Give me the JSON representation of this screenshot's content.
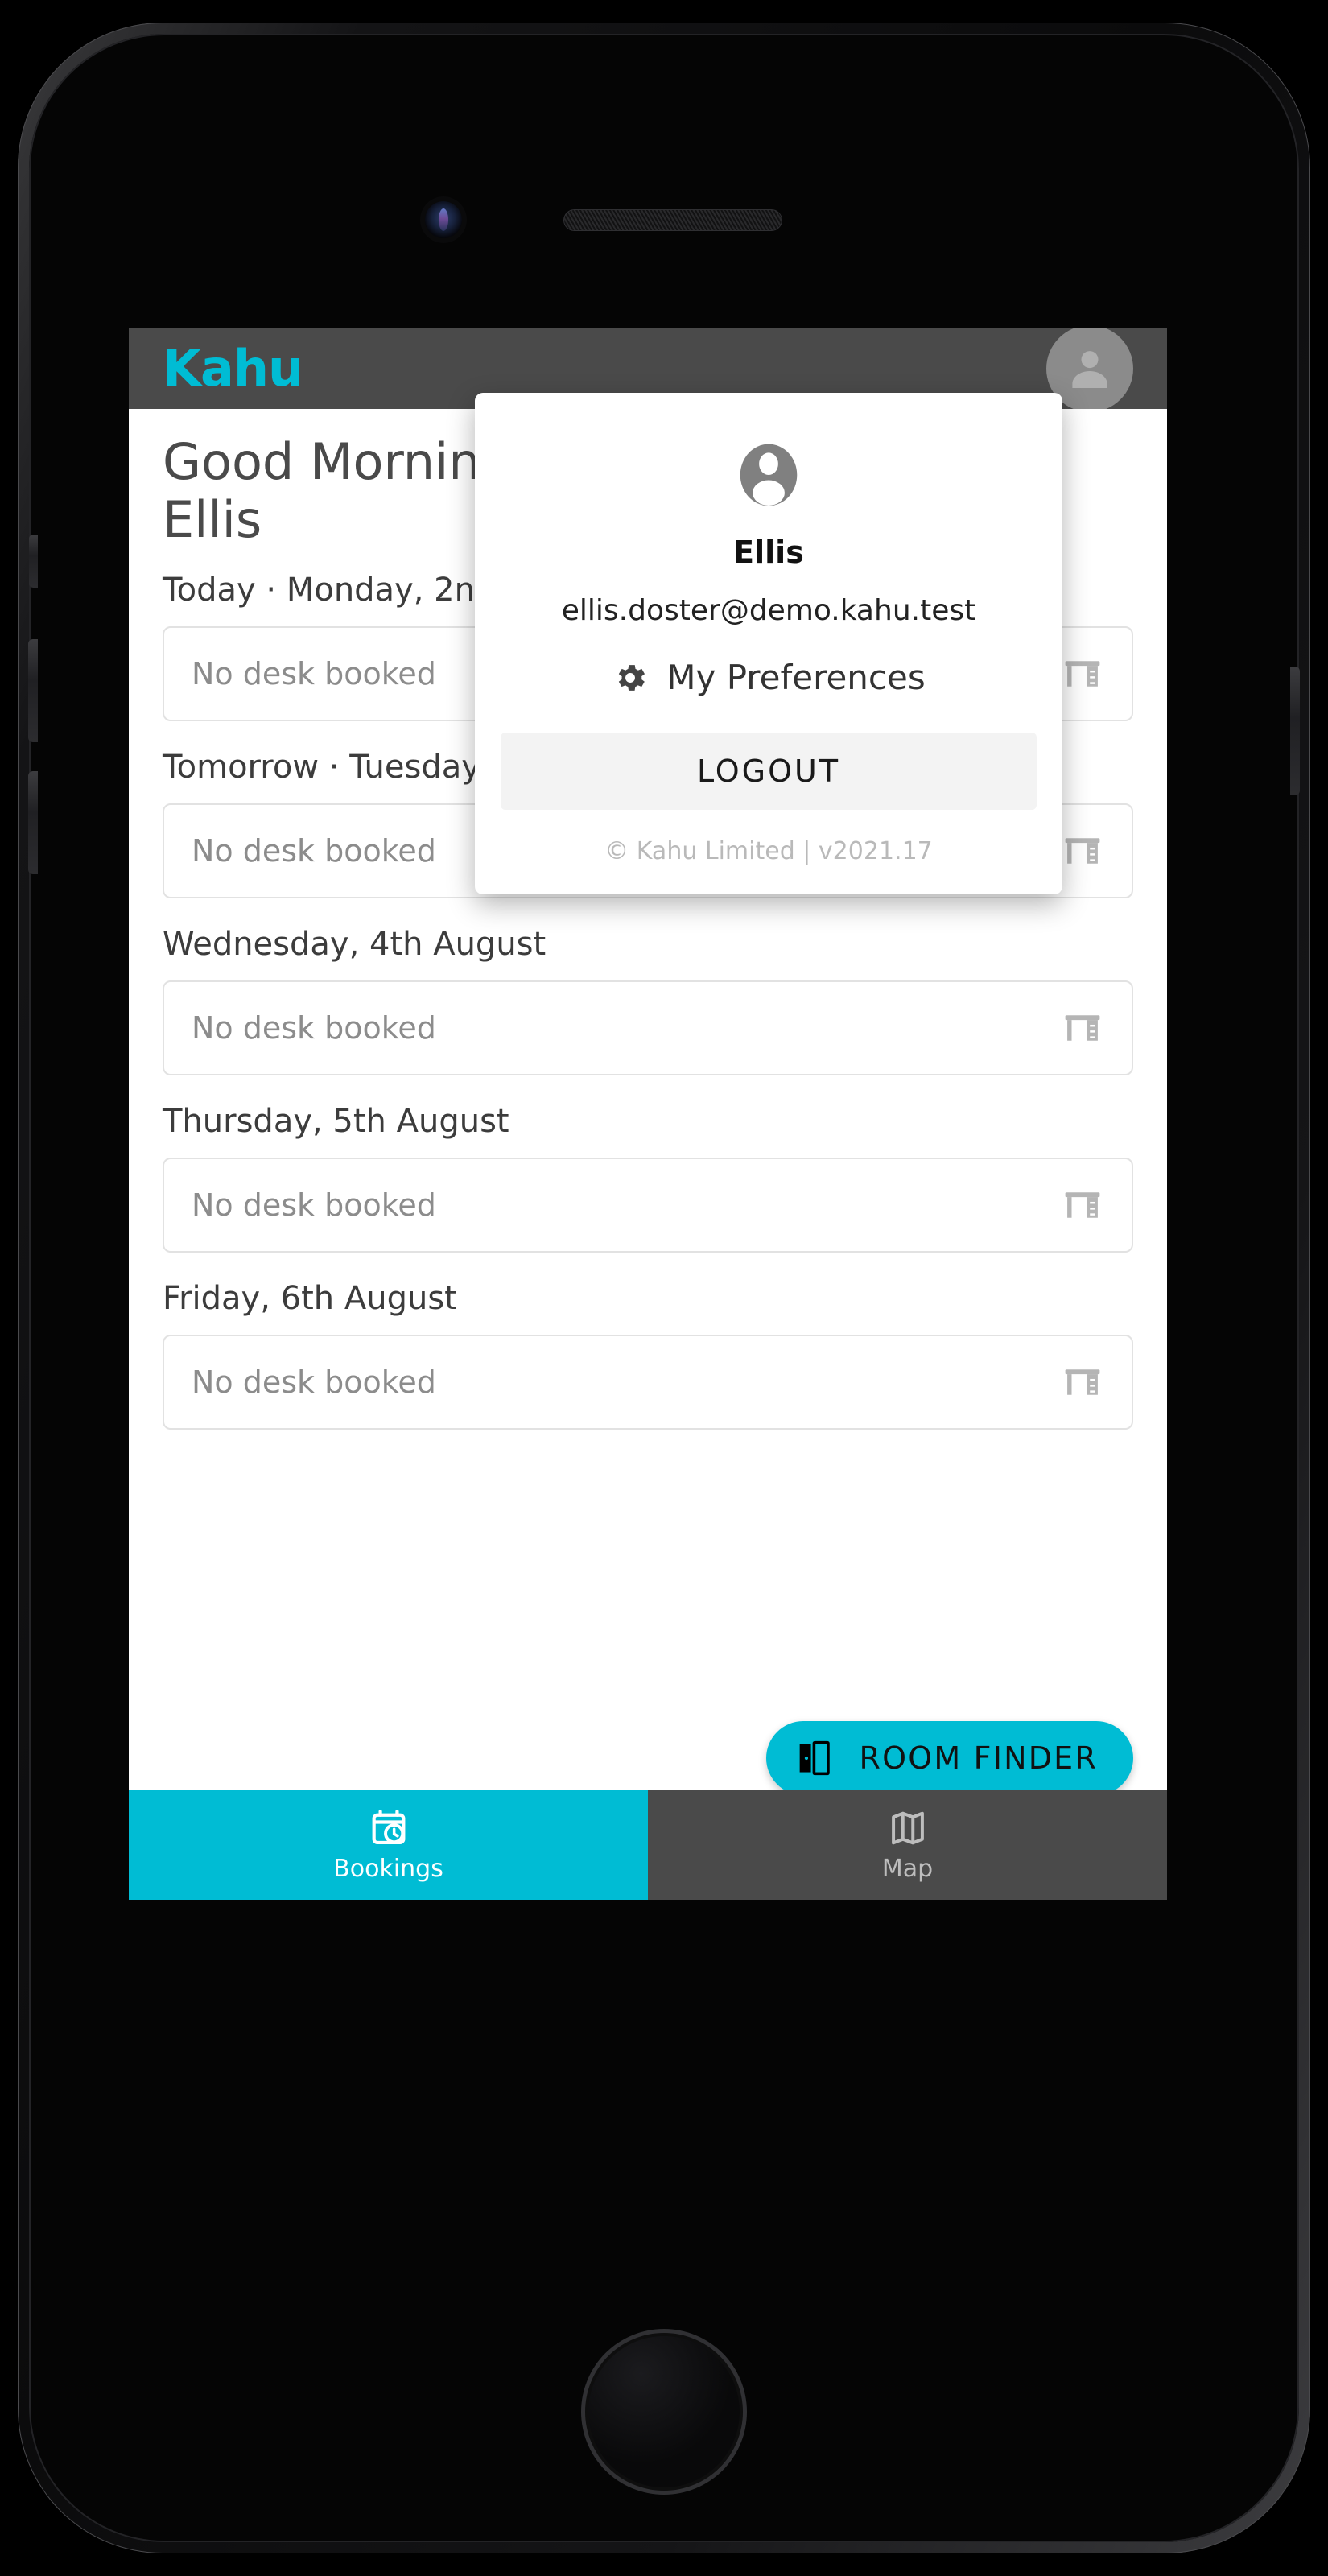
{
  "device": {
    "camera_icon": "front-camera-icon",
    "speaker_icon": "earpiece-speaker-icon",
    "home_button_icon": "home-button-icon"
  },
  "app": {
    "brand": "Kahu",
    "accent_color": "#00bcd4",
    "header_bg": "#4a4a4a",
    "avatar_icon": "account-circle-icon"
  },
  "greeting": {
    "text": "Good Morning, Ellis"
  },
  "bookings": [
    {
      "day_label": "Today · Monday, 2nd August",
      "status": "No desk booked",
      "icon": "desk-icon"
    },
    {
      "day_label": "Tomorrow · Tuesday, 3rd August",
      "status": "No desk booked",
      "icon": "desk-icon"
    },
    {
      "day_label": "Wednesday, 4th August",
      "status": "No desk booked",
      "icon": "desk-icon"
    },
    {
      "day_label": "Thursday, 5th August",
      "status": "No desk booked",
      "icon": "desk-icon"
    },
    {
      "day_label": "Friday, 6th August",
      "status": "No desk booked",
      "icon": "desk-icon"
    }
  ],
  "room_finder": {
    "label": "ROOM FINDER",
    "icon": "door-icon"
  },
  "tabs": [
    {
      "label": "Bookings",
      "icon": "calendar-clock-icon",
      "active": true
    },
    {
      "label": "Map",
      "icon": "map-icon",
      "active": false
    }
  ],
  "account_popup": {
    "avatar_icon": "account-circle-icon",
    "name": "Ellis",
    "email": "ellis.doster@demo.kahu.test",
    "preferences_label": "My Preferences",
    "preferences_icon": "gear-icon",
    "logout_label": "LOGOUT",
    "footer": "© Kahu Limited | v2021.17"
  }
}
